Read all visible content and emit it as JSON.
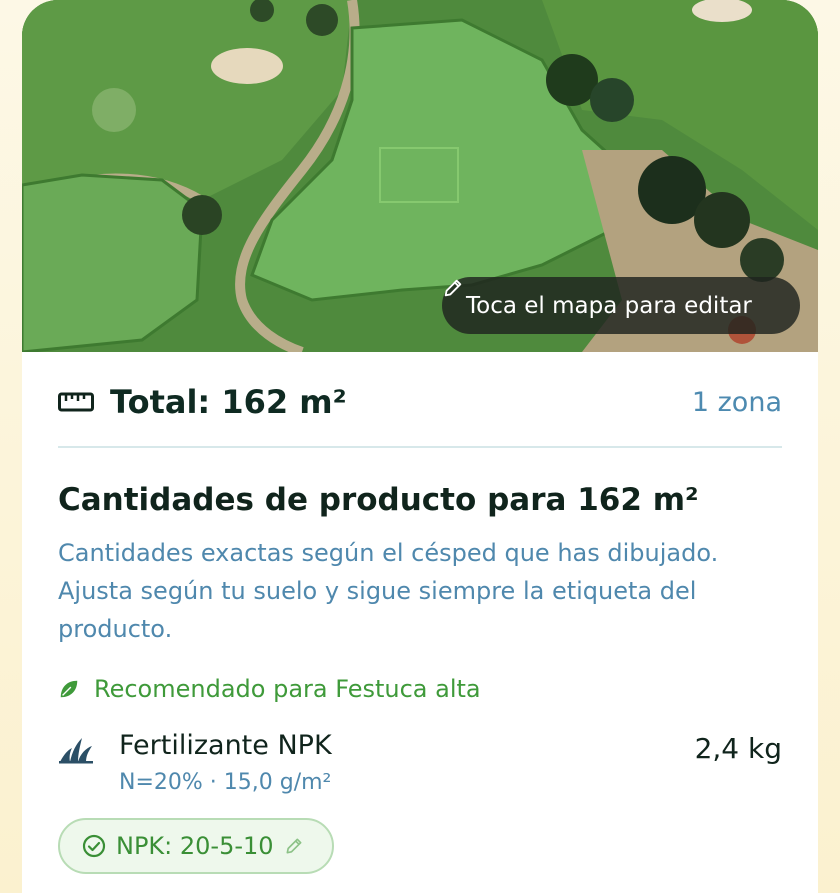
{
  "map": {
    "edit_hint": "Toca el mapa para editar",
    "hint_icon": "pencil-icon"
  },
  "summary": {
    "icon": "ruler-icon",
    "total": "Total: 162 m²",
    "zones": "1 zona"
  },
  "products": {
    "title": "Cantidades de producto para 162 m²",
    "description": "Cantidades exactas según el césped que has dibujado. Ajusta según tu suelo y sigue siempre la etiqueta del producto.",
    "recommended": "Recomendado para Festuca alta",
    "recommended_icon": "leaf-icon",
    "items": [
      {
        "icon": "grass-icon",
        "name": "Fertilizante NPK",
        "detail": "N=20% · 15,0 g/m²",
        "amount": "2,4 kg"
      }
    ],
    "npk_chip": {
      "label": "NPK: 20-5-10",
      "icon": "check-circle-icon",
      "edit_icon": "pencil-icon"
    }
  },
  "colors": {
    "accent_blue": "#4f88ad",
    "accent_green": "#3f9a3a",
    "text_dark": "#10241c"
  }
}
